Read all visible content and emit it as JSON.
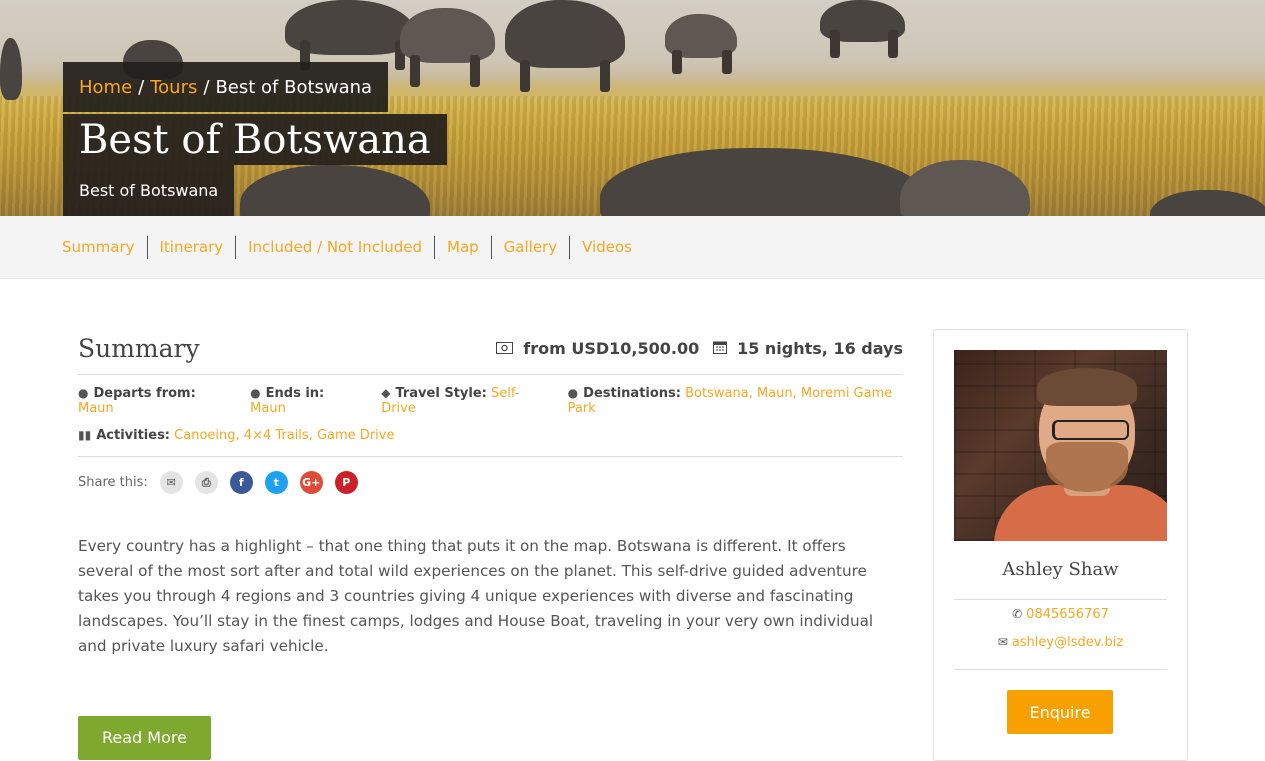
{
  "breadcrumb": {
    "items": [
      {
        "label": "Home",
        "link": true
      },
      {
        "label": "Tours",
        "link": true
      },
      {
        "label": "Best of Botswana",
        "link": false
      }
    ],
    "separator": "/"
  },
  "hero": {
    "title": "Best of Botswana",
    "subtitle": "Best of Botswana"
  },
  "tabs": [
    "Summary",
    "Itinerary",
    "Included / Not Included",
    "Map",
    "Gallery",
    "Videos"
  ],
  "summary": {
    "title": "Summary",
    "price": "from USD10,500.00",
    "duration": "15 nights, 16 days",
    "departs_label": "Departs from:",
    "departs_value": "Maun",
    "ends_label": "Ends in:",
    "ends_value": "Maun",
    "style_label": "Travel Style:",
    "style_value": "Self-Drive",
    "dest_label": "Destinations:",
    "destinations": [
      "Botswana",
      "Maun",
      "Moremi Game Park"
    ],
    "activities_label": "Activities:",
    "activities": [
      "Canoeing",
      "4×4 Trails",
      "Game Drive"
    ],
    "share_label": "Share this:",
    "description": "Every country has a highlight – that one thing that puts it on the map. Botswana is different. It offers several of the most sort after and total wild experiences on the planet. This self-drive guided adventure takes you through 4 regions and 3 countries giving 4 unique experiences with diverse and fascinating landscapes. You’ll stay in the finest camps, lodges and House Boat, traveling in your very own individual and private luxury safari vehicle.",
    "read_more": "Read More"
  },
  "agent": {
    "name": "Ashley Shaw",
    "phone": "0845656767",
    "email": "ashley@lsdev.biz",
    "enquire": "Enquire"
  },
  "colors": {
    "accent": "#f7a722",
    "read_more_bg": "#7fa82f",
    "enquire_bg": "#f7a000",
    "overlay_bg": "#221e1c"
  },
  "icons": {
    "price": "money-icon",
    "duration": "calendar-icon",
    "departs": "globe-icon",
    "ends": "globe-icon",
    "style": "tag-icon",
    "destinations": "globe-icon",
    "activities": "binoculars-icon",
    "phone": "phone-icon",
    "email": "envelope-icon"
  }
}
